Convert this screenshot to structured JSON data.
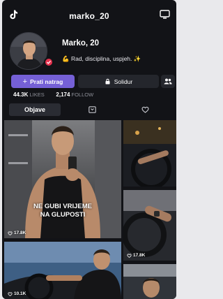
{
  "header": {
    "username": "marko_20"
  },
  "profile": {
    "display_name": "Marko, 20",
    "bio": "Rad, disciplina, uspjeh.",
    "bio_emoji_start": "💪",
    "bio_emoji_end": "✨"
  },
  "actions": {
    "follow_label": "Prati natrag",
    "solidur_label": "Solidur"
  },
  "stats": {
    "likes_count": "44.3K",
    "likes_label": "LIKES",
    "follow_count": "2,174",
    "follow_label": "FOLLOW"
  },
  "tabs": {
    "posts_label": "Objave"
  },
  "posts": [
    {
      "likes": "17.8K",
      "caption_line1": "NE GUBI VRIJEME",
      "caption_line2": "NA GLUPOSTI"
    },
    {
      "likes": ""
    },
    {
      "likes": "17.8K"
    },
    {
      "likes": "10.1K"
    },
    {
      "likes": ""
    },
    {
      "likes": ""
    }
  ],
  "colors": {
    "accent": "#7560d6",
    "background": "#121317",
    "badge": "#e6334f"
  }
}
